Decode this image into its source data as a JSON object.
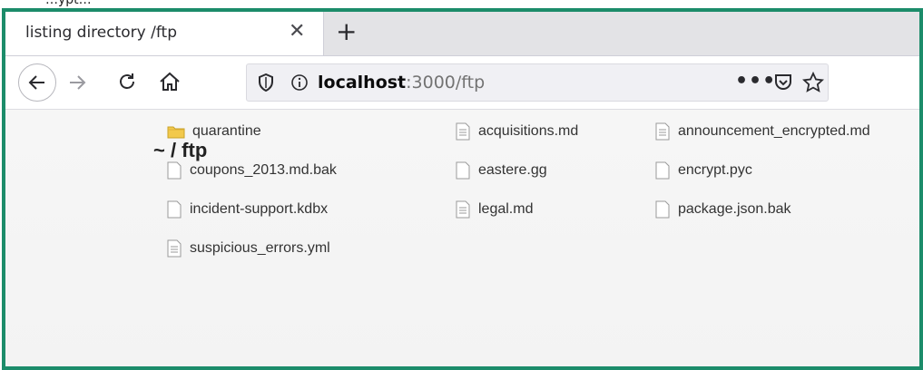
{
  "page_top_crop_text": "…ypt…",
  "browser": {
    "tab_title": "listing directory /ftp",
    "tab_close_icon": "close-icon",
    "new_tab_icon": "plus-icon",
    "url_host": "localhost",
    "url_rest": ":3000/ftp",
    "more_actions": "•••",
    "accent_frame_color": "#1c8c6a"
  },
  "listing": {
    "heading": "~ / ftp",
    "entries": [
      {
        "name": "quarantine",
        "type": "folder"
      },
      {
        "name": "acquisitions.md",
        "type": "text"
      },
      {
        "name": "announcement_encrypted.md",
        "type": "text"
      },
      {
        "name": "coupons_2013.md.bak",
        "type": "file"
      },
      {
        "name": "eastere.gg",
        "type": "file"
      },
      {
        "name": "encrypt.pyc",
        "type": "file"
      },
      {
        "name": "incident-support.kdbx",
        "type": "file"
      },
      {
        "name": "legal.md",
        "type": "text"
      },
      {
        "name": "package.json.bak",
        "type": "file"
      },
      {
        "name": "suspicious_errors.yml",
        "type": "text"
      }
    ]
  }
}
